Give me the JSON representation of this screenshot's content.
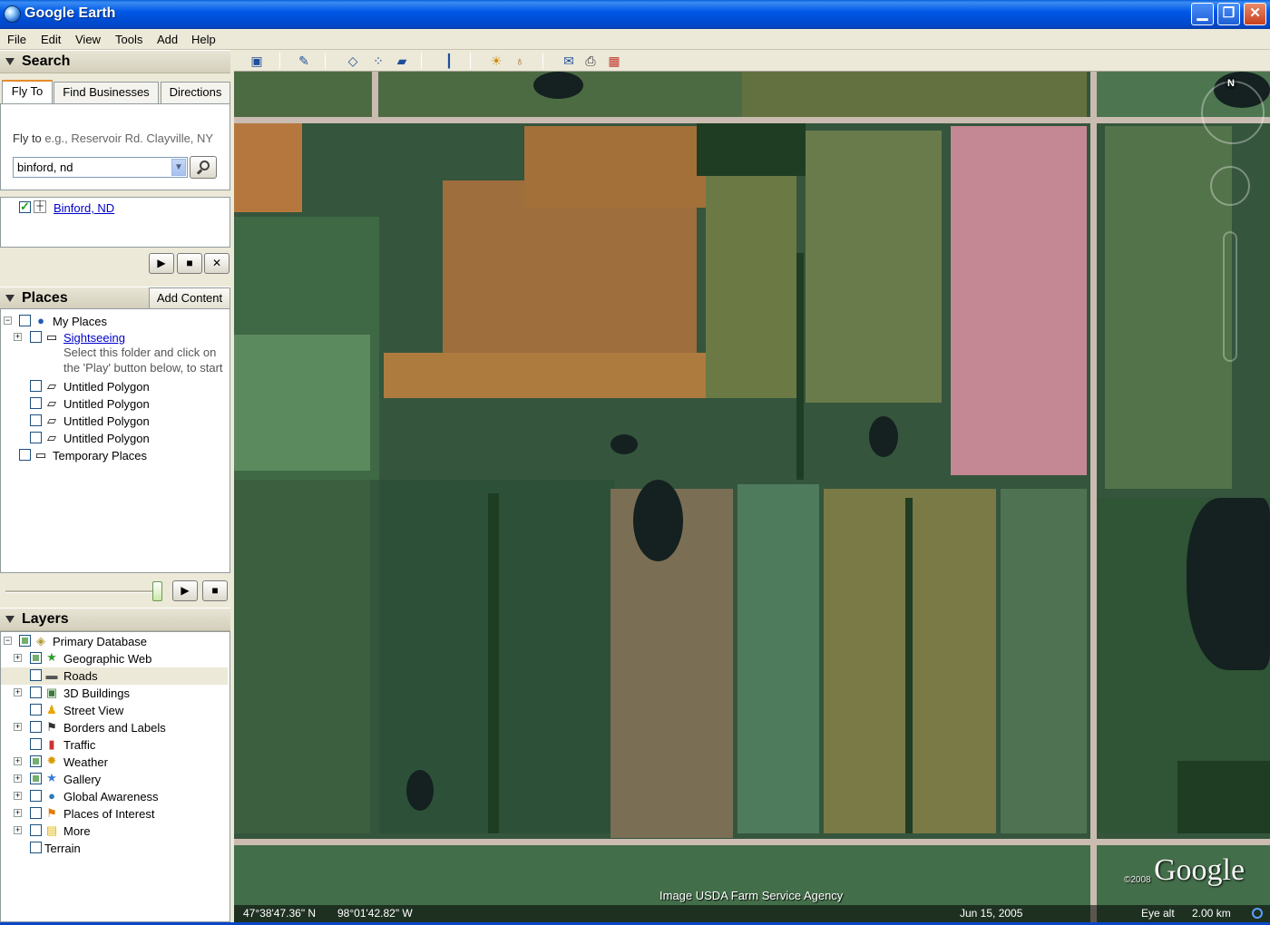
{
  "window": {
    "title": "Google Earth",
    "min_glyph": "▁",
    "max_glyph": "❐",
    "close_glyph": "✕"
  },
  "menu": [
    "File",
    "Edit",
    "View",
    "Tools",
    "Add",
    "Help"
  ],
  "search": {
    "header": "Search",
    "tabs": [
      "Fly To",
      "Find Businesses",
      "Directions"
    ],
    "fly_to_label": "Fly to",
    "fly_to_hint": "e.g., Reservoir Rd. Clayville, NY",
    "input_value": "binford, nd",
    "result": "Binford, ND"
  },
  "places": {
    "header": "Places",
    "add_content": "Add Content",
    "my_places": "My Places",
    "sightseeing": "Sightseeing",
    "sightseeing_note_1": "Select this folder and click on",
    "sightseeing_note_2": "the 'Play' button below, to start",
    "polygons": [
      "Untitled Polygon",
      "Untitled Polygon",
      "Untitled Polygon",
      "Untitled Polygon"
    ],
    "temporary": "Temporary Places"
  },
  "layers": {
    "header": "Layers",
    "primary": "Primary Database",
    "items": [
      "Geographic Web",
      "Roads",
      "3D Buildings",
      "Street View",
      "Borders and Labels",
      "Traffic",
      "Weather",
      "Gallery",
      "Global Awareness",
      "Places of Interest",
      "More"
    ],
    "terrain": "Terrain"
  },
  "map": {
    "north": "N",
    "logo": "Google",
    "logo_year": "©2008",
    "credit": "Image USDA Farm Service Agency",
    "lat": "47°38'47.36\" N",
    "lon": "98°01'42.82\" W",
    "date": "Jun 15, 2005",
    "eye_alt_label": "Eye alt",
    "eye_alt_value": "2.00 km"
  },
  "icons": {
    "play": "▶",
    "stop": "■",
    "close": "✕"
  },
  "colors": {
    "title_bar": "#0058e6",
    "link": "#0000cc",
    "tab_accent": "#e68b2c"
  }
}
